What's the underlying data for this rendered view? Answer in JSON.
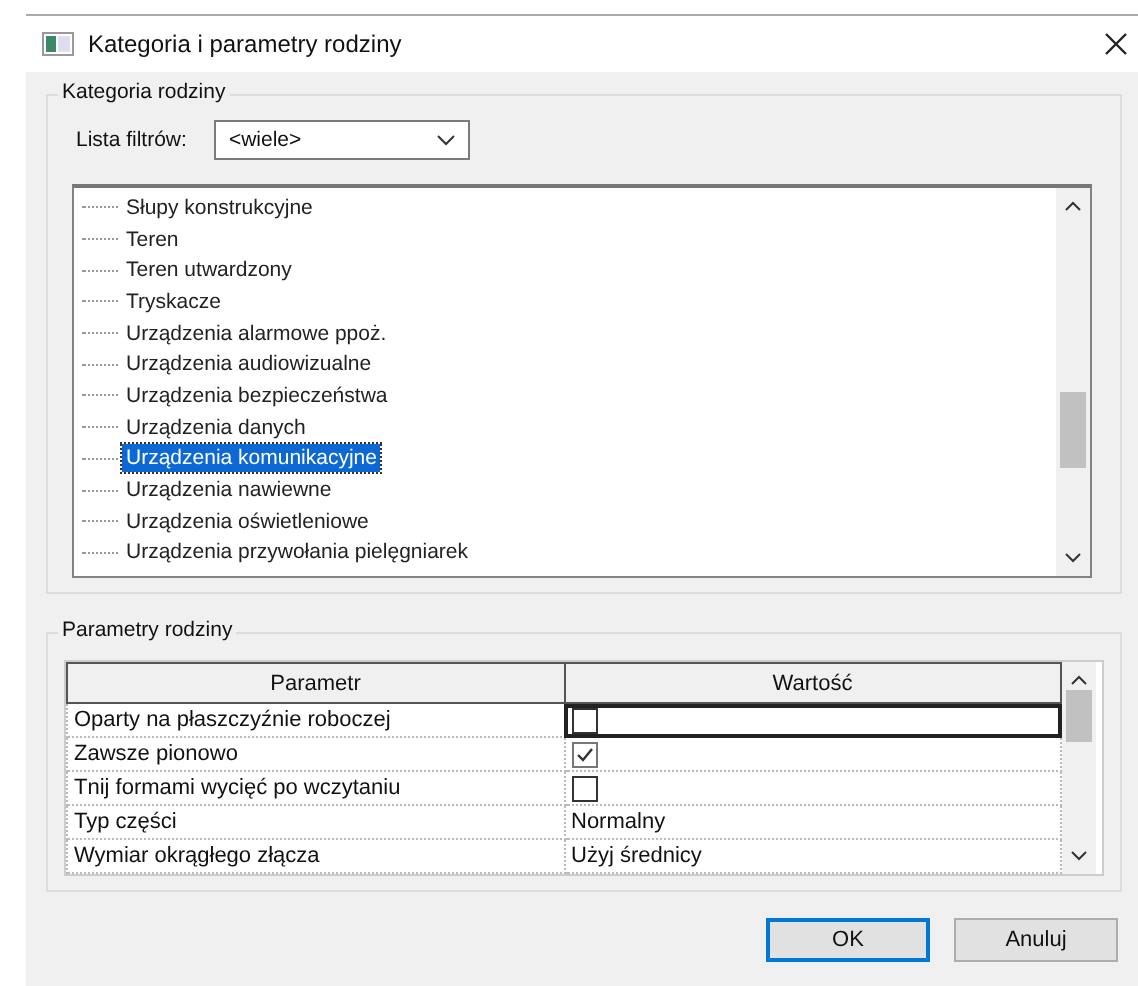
{
  "window": {
    "title": "Kategoria i parametry rodziny"
  },
  "category_group": {
    "title": "Kategoria rodziny",
    "filter_label": "Lista filtrów:",
    "filter_value": "<wiele>",
    "items": [
      {
        "label": "Słupy konstrukcyjne",
        "selected": false
      },
      {
        "label": "Teren",
        "selected": false
      },
      {
        "label": "Teren utwardzony",
        "selected": false
      },
      {
        "label": "Tryskacze",
        "selected": false
      },
      {
        "label": "Urządzenia alarmowe ppoż.",
        "selected": false
      },
      {
        "label": "Urządzenia audiowizualne",
        "selected": false
      },
      {
        "label": "Urządzenia bezpieczeństwa",
        "selected": false
      },
      {
        "label": "Urządzenia danych",
        "selected": false
      },
      {
        "label": "Urządzenia komunikacyjne",
        "selected": true
      },
      {
        "label": "Urządzenia nawiewne",
        "selected": false
      },
      {
        "label": "Urządzenia oświetleniowe",
        "selected": false
      },
      {
        "label": "Urządzenia przywołania pielęgniarek",
        "selected": false
      }
    ]
  },
  "parameters_group": {
    "title": "Parametry rodziny",
    "columns": [
      "Parametr",
      "Wartość"
    ],
    "rows": [
      {
        "name": "Oparty na płaszczyźnie roboczej",
        "kind": "checkbox",
        "checked": false,
        "selected": true
      },
      {
        "name": "Zawsze pionowo",
        "kind": "checkbox",
        "checked": true,
        "selected": false
      },
      {
        "name": "Tnij formami wycięć po wczytaniu",
        "kind": "checkbox",
        "checked": false,
        "selected": false
      },
      {
        "name": "Typ części",
        "kind": "text",
        "value": "Normalny",
        "selected": false
      },
      {
        "name": "Wymiar okrągłego złącza",
        "kind": "text",
        "value": "Użyj średnicy",
        "selected": false
      }
    ]
  },
  "buttons": [
    {
      "label": "OK",
      "default": true
    },
    {
      "label": "Anuluj",
      "default": false
    }
  ]
}
